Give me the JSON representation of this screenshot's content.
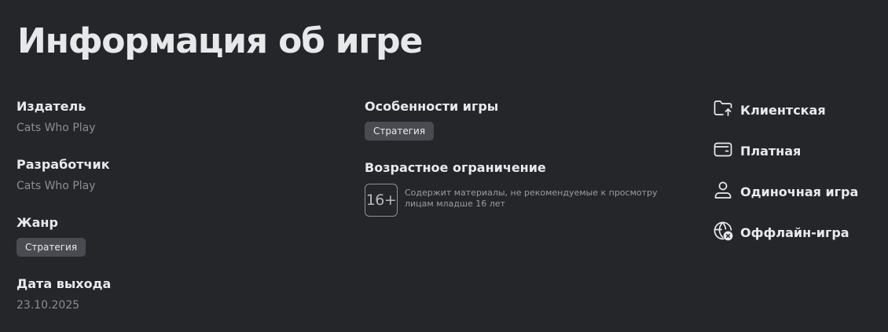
{
  "page_title": "Информация об игре",
  "details": {
    "publisher": {
      "label": "Издатель",
      "value": "Cats Who Play"
    },
    "developer": {
      "label": "Разработчик",
      "value": "Cats Who Play"
    },
    "genre": {
      "label": "Жанр",
      "tag": "Стратегия"
    },
    "release": {
      "label": "Дата выхода",
      "value": "23.10.2025"
    }
  },
  "features": {
    "label": "Особенности игры",
    "tag": "Стратегия"
  },
  "age": {
    "label": "Возрастное ограничение",
    "rating": "16+",
    "description": "Содержит материалы, не рекомендуемые к просмотру лицам младше 16 лет"
  },
  "attributes": [
    {
      "icon": "folder-upload-icon",
      "label": "Клиентская"
    },
    {
      "icon": "wallet-icon",
      "label": "Платная"
    },
    {
      "icon": "person-icon",
      "label": "Одиночная игра"
    },
    {
      "icon": "globe-offline-icon",
      "label": "Оффлайн-игра"
    }
  ],
  "colors": {
    "background": "#25262a",
    "text": "#e9eaec",
    "muted": "#8a8d93",
    "tag_bg": "#494b51"
  }
}
